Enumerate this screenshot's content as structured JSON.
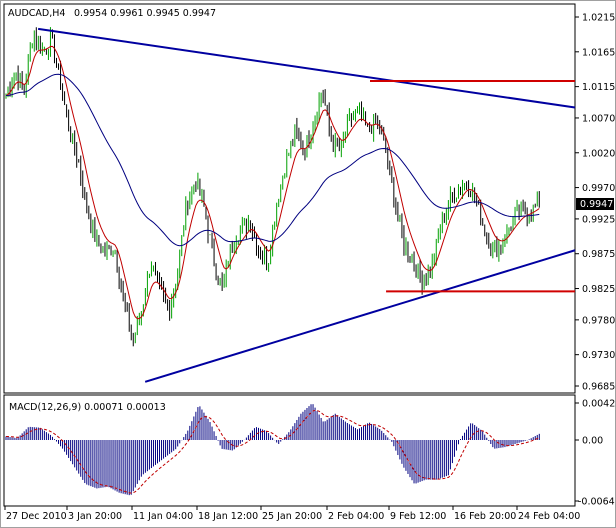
{
  "chart_data": [
    {
      "type": "ohlc",
      "title": "AUDCAD,H4",
      "ohlc_last": "0.9954 0.9961 0.9945 0.9947",
      "current_price": "0.9947",
      "ylim": [
        0.9685,
        1.0215
      ],
      "y_ticks": [
        "1.0215",
        "1.0165",
        "1.0115",
        "1.0070",
        "1.0020",
        "0.9970",
        "0.9925",
        "0.9875",
        "0.9825",
        "0.9780",
        "0.9730",
        "0.9685"
      ],
      "x_ticks": [
        "27 Dec 2010",
        "3 Jan 20:00",
        "11 Jan 04:00",
        "18 Jan 12:00",
        "25 Jan 20:00",
        "2 Feb 04:00",
        "9 Feb 12:00",
        "16 Feb 20:00",
        "24 Feb 04:00"
      ],
      "close_keypoints": [
        1.0102,
        1.0137,
        1.0109,
        1.0195,
        1.0166,
        1.0181,
        1.0123,
        1.0051,
        1.0008,
        0.9936,
        0.9893,
        0.9879,
        0.9886,
        0.9807,
        0.9749,
        0.9793,
        0.9865,
        0.9821,
        0.9793,
        0.985,
        0.9951,
        0.9979,
        0.9936,
        0.9865,
        0.9821,
        0.9893,
        0.9908,
        0.9922,
        0.9879,
        0.9865,
        0.9951,
        1.0008,
        1.0051,
        1.0022,
        1.0066,
        1.0109,
        1.0037,
        1.0022,
        1.0066,
        1.008,
        1.0051,
        1.0066,
        1.0022,
        0.9951,
        0.9893,
        0.9865,
        0.9836,
        0.985,
        0.9908,
        0.9951,
        0.9965,
        0.9979,
        0.9951,
        0.9908,
        0.9879,
        0.9893,
        0.9922,
        0.9936,
        0.9936,
        0.9947
      ],
      "moving_averages": [
        {
          "name": "fast MA",
          "color": "#c00000"
        },
        {
          "name": "slow MA",
          "color": "#000080"
        }
      ],
      "trendlines": [
        {
          "name": "upper-trendline",
          "color": "#0000a0",
          "from": {
            "bar_fraction": 0.06,
            "price": 1.0198
          },
          "to": {
            "bar_fraction": 1.07,
            "price": 1.0085
          }
        },
        {
          "name": "lower-trendline",
          "color": "#0000a0",
          "from": {
            "bar_fraction": 0.26,
            "price": 0.9691
          },
          "to": {
            "bar_fraction": 1.07,
            "price": 0.988
          }
        },
        {
          "name": "resistance-line",
          "color": "#d00000",
          "from": {
            "bar_fraction": 0.68,
            "price": 1.0123
          },
          "to": {
            "bar_fraction": 1.07,
            "price": 1.0123
          }
        },
        {
          "name": "support-line",
          "color": "#d00000",
          "from": {
            "bar_fraction": 0.71,
            "price": 0.9821
          },
          "to": {
            "bar_fraction": 1.07,
            "price": 0.9821
          }
        }
      ]
    },
    {
      "type": "bar",
      "title": "MACD(12,26,9) 0.00071 0.00013",
      "ylim": [
        -0.00645,
        0.0042
      ],
      "y_ticks": [
        "0.0042",
        "0.00",
        "-0.00645"
      ],
      "histogram_keypoints": [
        0.0004,
        0.0002,
        0.0015,
        0.0014,
        0.0005,
        -0.001,
        -0.003,
        -0.005,
        -0.0055,
        -0.0053,
        -0.006,
        -0.0063,
        -0.004,
        -0.003,
        -0.002,
        -0.001,
        0.001,
        0.004,
        0.002,
        -0.001,
        -0.0012,
        0,
        0.0015,
        0.001,
        -0.0005,
        0.001,
        0.003,
        0.0042,
        0.002,
        0.003,
        0.002,
        0.0012,
        0.002,
        0.0012,
        -0.0002,
        -0.003,
        -0.005,
        -0.0045,
        -0.0045,
        -0.004,
        0,
        0.002,
        0.001,
        -0.001,
        -0.0008,
        -0.0004,
        0,
        0.0007
      ],
      "histogram_color": "#000080",
      "signal_color": "#c00000"
    }
  ]
}
